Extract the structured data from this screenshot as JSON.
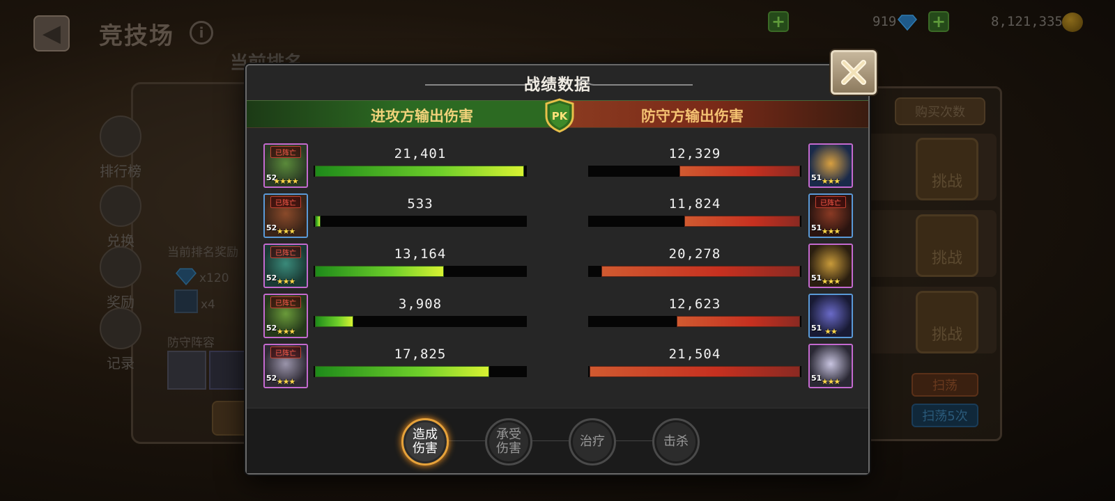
{
  "background": {
    "title": "竞技场",
    "section_label": "当前排名",
    "currency": {
      "gems": "919",
      "coins": "8,121,335"
    },
    "side_menu": [
      {
        "label": "排行榜"
      },
      {
        "label": "兑换"
      },
      {
        "label": "奖励"
      },
      {
        "label": "记录"
      }
    ],
    "reward_label": "当前排名奖励",
    "reward_gem_count": "x120",
    "reward_item_count": "x4",
    "defense_lineup_label": "防守阵容",
    "buy_times_label": "购买次数",
    "challenge_label": "挑战",
    "sweep_label": "扫荡",
    "sweep5_label": "扫荡5次"
  },
  "modal": {
    "title": "战绩数据",
    "attacker_header": "进攻方输出伤害",
    "defender_header": "防守方输出伤害",
    "pk_label": "PK",
    "dead_label": "已阵亡",
    "attackers": [
      {
        "value": "21,401",
        "fill": 0.995,
        "level": "52",
        "stars": "★★★★",
        "dead": true,
        "frame": "purple",
        "face": [
          "#2a3a24",
          "#5a8a3a"
        ]
      },
      {
        "value": "533",
        "fill": 0.025,
        "level": "52",
        "stars": "★★★",
        "dead": true,
        "frame": "blue",
        "face": [
          "#3a2418",
          "#8a4a2a"
        ]
      },
      {
        "value": "13,164",
        "fill": 0.612,
        "level": "52",
        "stars": "★★★",
        "dead": true,
        "frame": "purple",
        "face": [
          "#1a3a34",
          "#3a8a7a"
        ]
      },
      {
        "value": "3,908",
        "fill": 0.182,
        "level": "52",
        "stars": "★★★",
        "dead": true,
        "frame": "purple",
        "face": [
          "#24381a",
          "#6a9a3a"
        ]
      },
      {
        "value": "17,825",
        "fill": 0.829,
        "level": "52",
        "stars": "★★★",
        "dead": true,
        "frame": "purple",
        "face": [
          "#2e2a34",
          "#9a94aa"
        ]
      }
    ],
    "defenders": [
      {
        "value": "12,329",
        "fill": 0.573,
        "level": "51",
        "stars": "★★★",
        "dead": false,
        "frame": "purple",
        "face": [
          "#1a2a4a",
          "#d8a040"
        ]
      },
      {
        "value": "11,824",
        "fill": 0.55,
        "level": "51",
        "stars": "★★★",
        "dead": true,
        "frame": "blue",
        "face": [
          "#2a1410",
          "#8a3a24"
        ]
      },
      {
        "value": "20,278",
        "fill": 0.943,
        "level": "51",
        "stars": "★★★",
        "dead": false,
        "frame": "purple",
        "face": [
          "#2a1e10",
          "#c89a3a"
        ]
      },
      {
        "value": "12,623",
        "fill": 0.587,
        "level": "51",
        "stars": "★★",
        "dead": false,
        "frame": "blue",
        "face": [
          "#181a34",
          "#6a6ac8"
        ]
      },
      {
        "value": "21,504",
        "fill": 1.0,
        "level": "51",
        "stars": "★★★",
        "dead": false,
        "frame": "purple",
        "face": [
          "#2a2834",
          "#c8c4e0"
        ]
      }
    ],
    "tabs": [
      {
        "label": "造成\n伤害",
        "active": true
      },
      {
        "label": "承受\n伤害",
        "active": false
      },
      {
        "label": "治疗",
        "active": false
      },
      {
        "label": "击杀",
        "active": false
      }
    ]
  },
  "colors": {
    "attack_bar": "#6ecf2a",
    "defense_bar": "#c63020",
    "active_tab_glow": "#e6a23a"
  }
}
